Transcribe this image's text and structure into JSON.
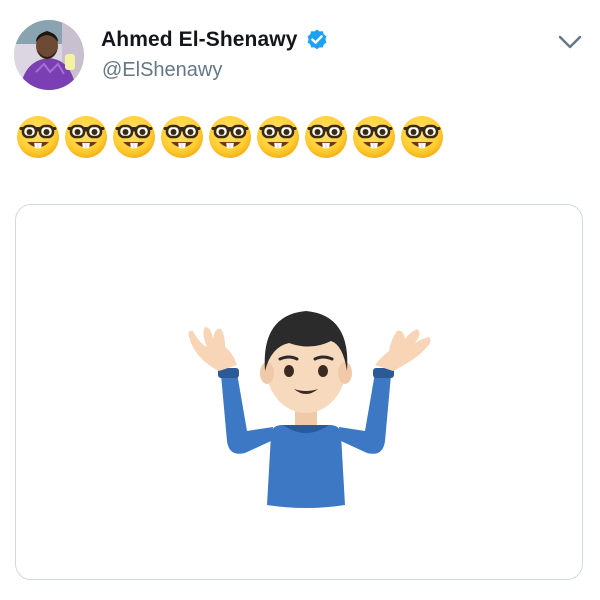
{
  "tweet": {
    "author": {
      "display_name": "Ahmed El-Shenawy",
      "handle": "@ElShenawy",
      "verified": true,
      "avatar_icon": "goalkeeper-profile-photo"
    },
    "menu_icon": "chevron-down-icon",
    "text_emojis": [
      "nerd-face",
      "nerd-face",
      "nerd-face",
      "nerd-face",
      "nerd-face",
      "nerd-face",
      "nerd-face",
      "nerd-face",
      "nerd-face"
    ],
    "media": {
      "type": "image",
      "icon": "man-shrugging-emoji"
    }
  },
  "colors": {
    "name": "#14171a",
    "handle": "#657786",
    "verified_badge": "#1da1f2",
    "card_border": "#d4d9de",
    "shirt": "#3c78c4"
  }
}
